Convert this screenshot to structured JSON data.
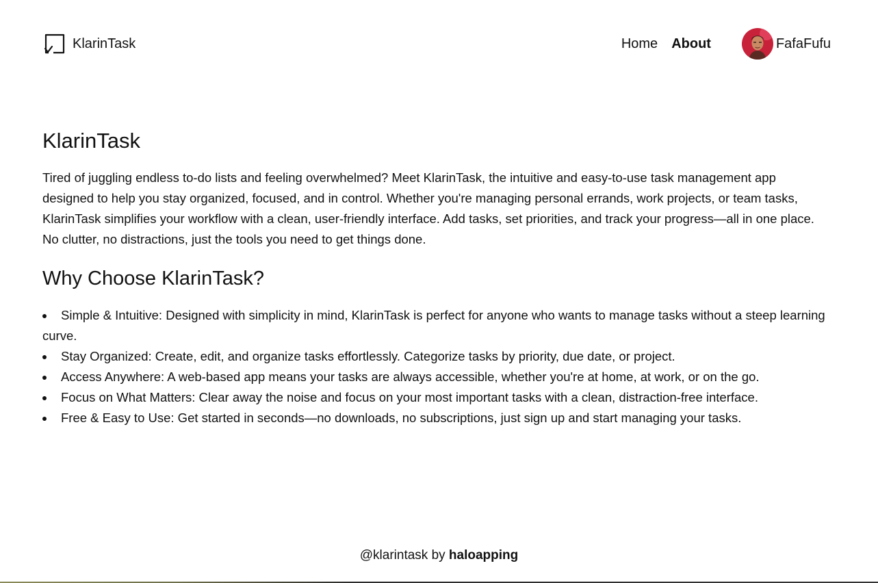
{
  "header": {
    "brand": {
      "name": "KlarinTask",
      "icon": "checkbox-task-icon"
    },
    "nav": [
      {
        "label": "Home",
        "active": false
      },
      {
        "label": "About",
        "active": true
      }
    ],
    "user": {
      "name": "FafaFufu",
      "avatar": "user-avatar"
    }
  },
  "main": {
    "title": "KlarinTask",
    "intro": "Tired of juggling endless to-do lists and feeling overwhelmed? Meet KlarinTask, the intuitive and easy-to-use task management app designed to help you stay organized, focused, and in control. Whether you're managing personal errands, work projects, or team tasks, KlarinTask simplifies your workflow with a clean, user-friendly interface. Add tasks, set priorities, and track your progress—all in one place. No clutter, no distractions, just the tools you need to get things done.",
    "why_title": "Why Choose KlarinTask?",
    "features": [
      {
        "text": "Simple & Intuitive: Designed with simplicity in mind, KlarinTask is perfect for anyone who wants to manage tasks without a steep learning curve."
      },
      {
        "text": "Stay Organized: Create, edit, and organize tasks effortlessly. Categorize tasks by priority, due date, or project."
      },
      {
        "text": "Access Anywhere: A web-based app means your tasks are always accessible, whether you're at home, at work, or on the go."
      },
      {
        "text": "Focus on What Matters: Clear away the noise and focus on your most important tasks with a clean, distraction-free interface."
      },
      {
        "text": "Free & Easy to Use: Get started in seconds—no downloads, no subscriptions, just sign up and start managing your tasks."
      }
    ]
  },
  "footer": {
    "prefix": "@klarintask by",
    "link": "haloapping"
  },
  "colors": {
    "text": "#111111",
    "background": "#ffffff",
    "avatar_bg": "#c8213a"
  }
}
